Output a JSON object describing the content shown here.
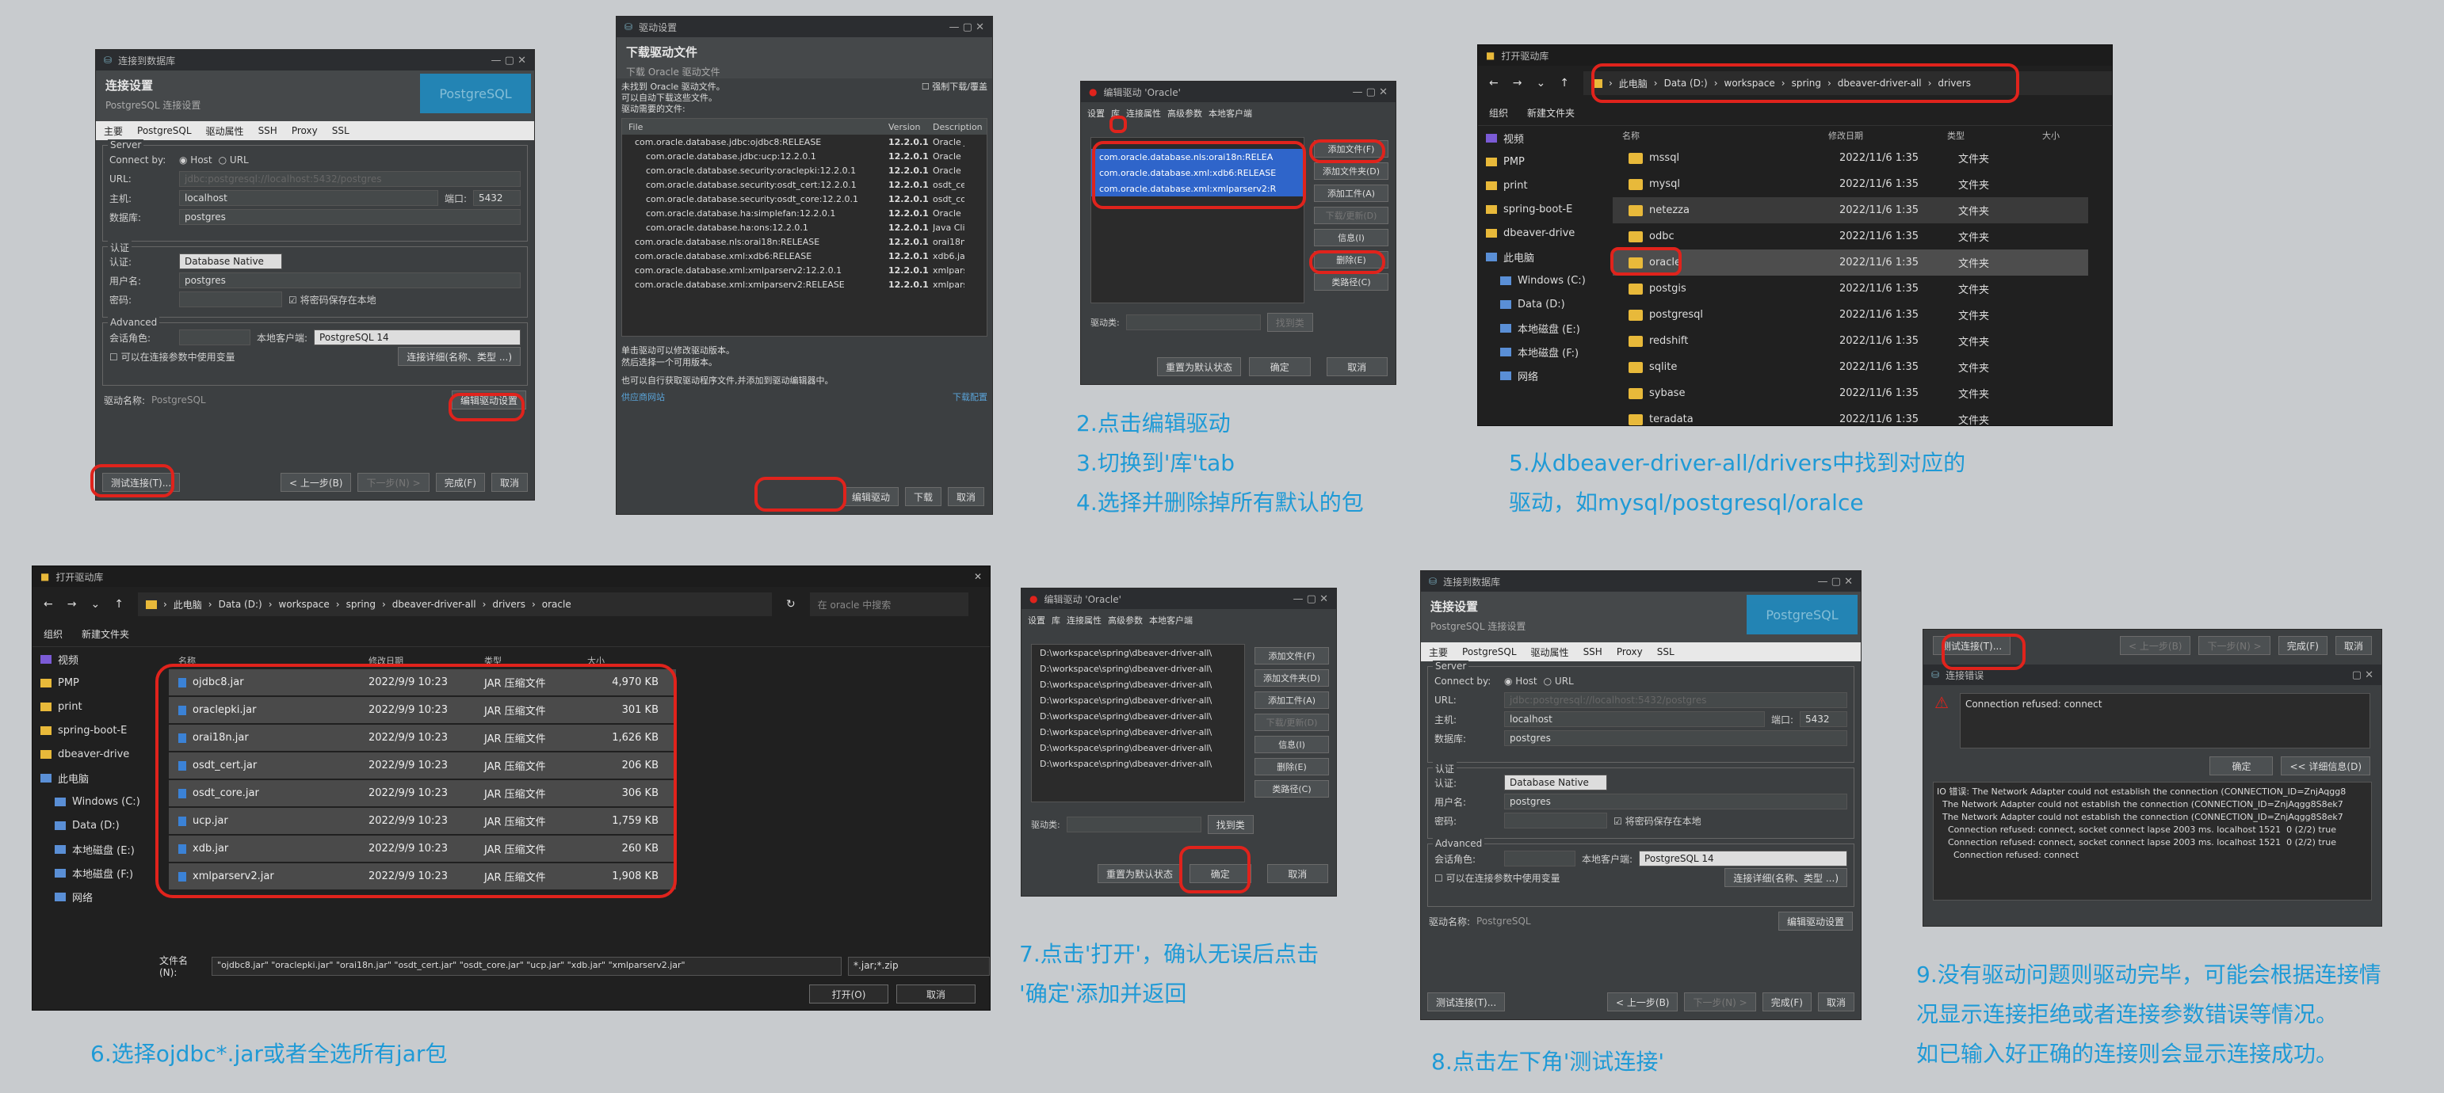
{
  "p1": {
    "title": "连接到数据库",
    "head": "连接设置",
    "sub": "PostgreSQL 连接设置",
    "badge": "PostgreSQL",
    "tabs": [
      "主要",
      "PostgreSQL",
      "驱动属性",
      "SSH",
      "Proxy",
      "SSL"
    ],
    "server": "Server",
    "connect_by": "Connect by:",
    "host": "Host",
    "url": "URL",
    "url_lbl": "URL:",
    "url_val": "jdbc:postgresql://localhost:5432/postgres",
    "host_lbl": "主机:",
    "host_val": "localhost",
    "port_lbl": "端口:",
    "port_val": "5432",
    "db_lbl": "数据库:",
    "db_val": "postgres",
    "auth": "认证",
    "auth_lbl": "认证:",
    "auth_val": "Database Native",
    "user_lbl": "用户名:",
    "user_val": "postgres",
    "pwd_lbl": "密码:",
    "save_pwd": "将密码保存在本地",
    "adv": "Advanced",
    "role_lbl": "会话角色:",
    "client_lbl": "本地客户端:",
    "client_val": "PostgreSQL 14",
    "show_all": "可以在连接参数中使用变量",
    "conn_detail": "连接详细(名称、类型 ...)",
    "drv_lbl": "驱动名称:",
    "drv_val": "PostgreSQL",
    "edit_drv": "编辑驱动设置",
    "btn_test": "测试连接(T)...",
    "btn_prev": "< 上一步(B)",
    "btn_next": "下一步(N) >",
    "btn_finish": "完成(F)",
    "btn_cancel": "取消"
  },
  "p2": {
    "title": "驱动设置",
    "head": "下载驱动文件",
    "sub": "下载 Oracle 驱动文件",
    "notice1": "未找到 Oracle 驱动文件。",
    "notice2": "可以自动下载这些文件。",
    "notice3": "驱动需要的文件:",
    "force": "强制下载/覆盖",
    "cols": [
      "File",
      "Version",
      "Description"
    ],
    "files": [
      [
        "com.oracle.database.jdbc:ojdbc8:RELEASE",
        "12.2.0.1",
        "Oracle JDB"
      ],
      [
        "com.oracle.database.jdbc:ucp:12.2.0.1",
        "12.2.0.1",
        "Oracle Uni"
      ],
      [
        "com.oracle.database.security:oraclepki:12.2.0.1",
        "12.2.0.1",
        "Oracle PKI"
      ],
      [
        "com.oracle.database.security:osdt_cert:12.2.0.1",
        "12.2.0.1",
        "osdt_cert"
      ],
      [
        "com.oracle.database.security:osdt_core:12.2.0.1",
        "12.2.0.1",
        "osdt_core"
      ],
      [
        "com.oracle.database.ha:simplefan:12.2.0.1",
        "12.2.0.1",
        "Oracle Sim"
      ],
      [
        "com.oracle.database.ha:ons:12.2.0.1",
        "12.2.0.1",
        "Java Client"
      ],
      [
        "com.oracle.database.nls:orai18n:RELEASE",
        "12.2.0.1",
        "orai18n.jar"
      ],
      [
        "com.oracle.database.xml:xdb6:RELEASE",
        "12.2.0.1",
        "xdb6.jar"
      ],
      [
        "com.oracle.database.xml:xmlparserv2:12.2.0.1",
        "12.2.0.1",
        "xmlparser"
      ],
      [
        "com.oracle.database.xml:xmlparserv2:RELEASE",
        "12.2.0.1",
        "xmlparser"
      ]
    ],
    "hint1": "单击驱动可以修改驱动版本。",
    "hint2": "然后选择一个可用版本。",
    "hint3": "也可以自行获取驱动程序文件,并添加到驱动编辑器中。",
    "link1": "供应商网站",
    "link2": "下载配置",
    "btn_edit": "编辑驱动",
    "btn_down": "下载",
    "btn_cancel": "取消"
  },
  "p3": {
    "title": "编辑驱动 'Oracle'",
    "tabs": [
      "设置",
      "库",
      "连接属性",
      "高级参数",
      "本地客户端"
    ],
    "libs": [
      "com.oracle.database.nls:orai18n:RELEA",
      "com.oracle.database.xml:xdb6:RELEASE",
      "com.oracle.database.xml:xmlparserv2:R"
    ],
    "btns": [
      "添加文件(F)",
      "添加文件夹(D)",
      "添加工件(A)",
      "下载/更新(D)",
      "信息(I)",
      "删除(E)",
      "类路径(C)"
    ],
    "drv_cls": "驱动类:",
    "find": "找到类",
    "reset": "重置为默认状态",
    "ok": "确定",
    "cancel": "取消"
  },
  "cap1": [
    "2.点击编辑驱动",
    "3.切换到'库'tab",
    "4.选择并删除掉所有默认的包"
  ],
  "p4": {
    "title": "打开驱动库",
    "path": [
      "此电脑",
      "Data (D:)",
      "workspace",
      "spring",
      "dbeaver-driver-all",
      "drivers"
    ],
    "org": "组织",
    "newf": "新建文件夹",
    "side": [
      "视频",
      "PMP",
      "print",
      "spring-boot-E",
      "dbeaver-drive",
      "此电脑",
      "Windows (C:)",
      "Data (D:)",
      "本地磁盘 (E:)",
      "本地磁盘 (F:)",
      "网络"
    ],
    "cols": [
      "名称",
      "修改日期",
      "类型",
      "大小"
    ],
    "rows": [
      [
        "mssql",
        "2022/11/6 1:35",
        "文件夹"
      ],
      [
        "mysql",
        "2022/11/6 1:35",
        "文件夹"
      ],
      [
        "netezza",
        "2022/11/6 1:35",
        "文件夹"
      ],
      [
        "odbc",
        "2022/11/6 1:35",
        "文件夹"
      ],
      [
        "oracle",
        "2022/11/6 1:35",
        "文件夹"
      ],
      [
        "postgis",
        "2022/11/6 1:35",
        "文件夹"
      ],
      [
        "postgresql",
        "2022/11/6 1:35",
        "文件夹"
      ],
      [
        "redshift",
        "2022/11/6 1:35",
        "文件夹"
      ],
      [
        "sqlite",
        "2022/11/6 1:35",
        "文件夹"
      ],
      [
        "sybase",
        "2022/11/6 1:35",
        "文件夹"
      ],
      [
        "teradata",
        "2022/11/6 1:35",
        "文件夹"
      ]
    ]
  },
  "cap2": [
    "5.从dbeaver-driver-all/drivers中找到对应的",
    "驱动，如mysql/postgresql/oralce"
  ],
  "p5": {
    "title": "打开驱动库",
    "path": [
      "此电脑",
      "Data (D:)",
      "workspace",
      "spring",
      "dbeaver-driver-all",
      "drivers",
      "oracle"
    ],
    "search": "在 oracle 中搜索",
    "org": "组织",
    "newf": "新建文件夹",
    "side": [
      "视频",
      "PMP",
      "print",
      "spring-boot-E",
      "dbeaver-drive",
      "此电脑",
      "Windows (C:)",
      "Data (D:)",
      "本地磁盘 (E:)",
      "本地磁盘 (F:)",
      "网络"
    ],
    "cols": [
      "名称",
      "修改日期",
      "类型",
      "大小"
    ],
    "rows": [
      [
        "ojdbc8.jar",
        "2022/9/9 10:23",
        "JAR 压缩文件",
        "4,970 KB"
      ],
      [
        "oraclepki.jar",
        "2022/9/9 10:23",
        "JAR 压缩文件",
        "301 KB"
      ],
      [
        "orai18n.jar",
        "2022/9/9 10:23",
        "JAR 压缩文件",
        "1,626 KB"
      ],
      [
        "osdt_cert.jar",
        "2022/9/9 10:23",
        "JAR 压缩文件",
        "206 KB"
      ],
      [
        "osdt_core.jar",
        "2022/9/9 10:23",
        "JAR 压缩文件",
        "306 KB"
      ],
      [
        "ucp.jar",
        "2022/9/9 10:23",
        "JAR 压缩文件",
        "1,759 KB"
      ],
      [
        "xdb.jar",
        "2022/9/9 10:23",
        "JAR 压缩文件",
        "260 KB"
      ],
      [
        "xmlparserv2.jar",
        "2022/9/9 10:23",
        "JAR 压缩文件",
        "1,908 KB"
      ]
    ],
    "fn_lbl": "文件名(N):",
    "fn_val": "\"ojdbc8.jar\" \"oraclepki.jar\" \"orai18n.jar\" \"osdt_cert.jar\" \"osdt_core.jar\" \"ucp.jar\" \"xdb.jar\" \"xmlparserv2.jar\"",
    "filter": "*.jar;*.zip",
    "open": "打开(O)",
    "cancel": "取消"
  },
  "cap3": "6.选择ojdbc*.jar或者全选所有jar包",
  "p6": {
    "title": "编辑驱动 'Oracle'",
    "tabs": [
      "设置",
      "库",
      "连接属性",
      "高级参数",
      "本地客户端"
    ],
    "libs": [
      "D:\\workspace\\spring\\dbeaver-driver-all\\",
      "D:\\workspace\\spring\\dbeaver-driver-all\\",
      "D:\\workspace\\spring\\dbeaver-driver-all\\",
      "D:\\workspace\\spring\\dbeaver-driver-all\\",
      "D:\\workspace\\spring\\dbeaver-driver-all\\",
      "D:\\workspace\\spring\\dbeaver-driver-all\\",
      "D:\\workspace\\spring\\dbeaver-driver-all\\",
      "D:\\workspace\\spring\\dbeaver-driver-all\\"
    ],
    "btns": [
      "添加文件(F)",
      "添加文件夹(D)",
      "添加工件(A)",
      "下载/更新(D)",
      "信息(I)",
      "删除(E)",
      "类路径(C)"
    ],
    "drv_cls": "驱动类:",
    "find": "找到类",
    "reset": "重置为默认状态",
    "ok": "确定",
    "cancel": "取消"
  },
  "cap4": [
    "7.点击'打开'，确认无误后点击",
    "'确定'添加并返回"
  ],
  "cap5": "8.点击左下角'测试连接'",
  "p8": {
    "top_btns": [
      "测试连接(T)...",
      "< 上一步(B)",
      "下一步(N) >",
      "完成(F)",
      "取消"
    ],
    "title": "连接错误",
    "msg": "Connection refused: connect",
    "ok": "确定",
    "detail": "<< 详细信息(D)",
    "log": [
      "IO 错误: The Network Adapter could not establish the connection (CONNECTION_ID=ZnjAqgg8",
      "  The Network Adapter could not establish the connection (CONNECTION_ID=ZnjAqgg8S8ek7",
      "  The Network Adapter could not establish the connection (CONNECTION_ID=ZnjAqgg8S8ek7",
      "    Connection refused: connect, socket connect lapse 2003 ms. localhost 1521  0 (2/2) true",
      "    Connection refused: connect, socket connect lapse 2003 ms. localhost 1521  0 (2/2) true",
      "      Connection refused: connect"
    ]
  },
  "cap6": [
    "9.没有驱动问题则驱动完毕，可能会根据连接情",
    "况显示连接拒绝或者连接参数错误等情况。",
    "如已输入好正确的连接则会显示连接成功。"
  ],
  "colors": {
    "caption": "#1f9ad6",
    "highlight": "#e0231c",
    "panel": "#3c3f41"
  }
}
